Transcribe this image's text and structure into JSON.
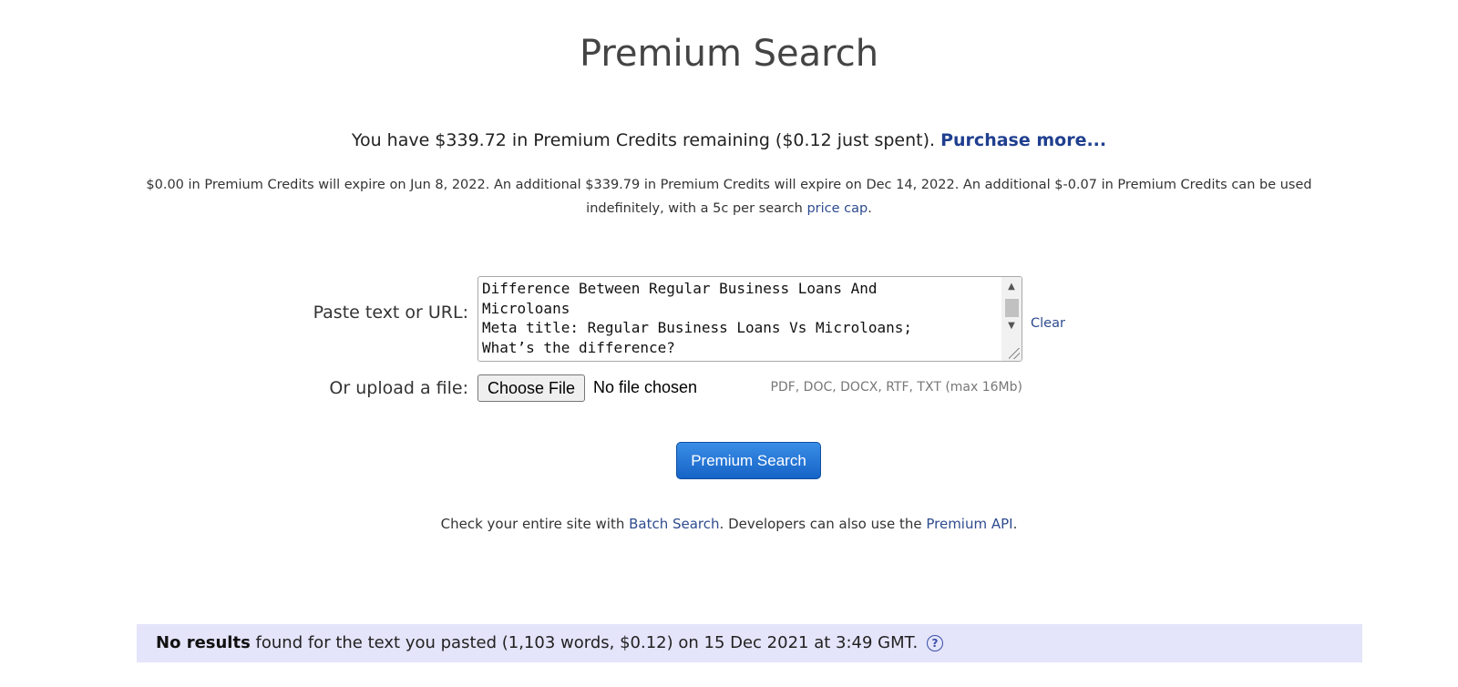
{
  "page": {
    "title": "Premium Search"
  },
  "credits": {
    "line_prefix": "You have $339.72 in Premium Credits remaining ($0.12 just spent). ",
    "purchase_link": "Purchase more...",
    "expiry_text": "$0.00 in Premium Credits will expire on Jun 8, 2022. An additional $339.79 in Premium Credits will expire on Dec 14, 2022. An additional $-0.07 in Premium Credits can be used indefinitely, with a 5c per search ",
    "price_cap_link": "price cap",
    "expiry_suffix": "."
  },
  "form": {
    "paste_label": "Paste text or URL:",
    "textarea_value": "Difference Between Regular Business Loans And\nMicroloans\nMeta title: Regular Business Loans Vs Microloans;\nWhat’s the difference?",
    "clear_link": "Clear",
    "upload_label": "Or upload a file:",
    "choose_file_button": "Choose File",
    "file_status": "No file chosen",
    "file_hint": "PDF, DOC, DOCX, RTF, TXT (max 16Mb)",
    "submit_button": "Premium Search"
  },
  "batch": {
    "prefix": "Check your entire site with ",
    "batch_link": "Batch Search",
    "middle": ". Developers can also use the ",
    "api_link": "Premium API",
    "suffix": "."
  },
  "results": {
    "bold": "No results",
    "text": " found for the text you pasted (1,103 words, $0.12) on 15 Dec 2021 at 3:49 GMT.",
    "help_icon": "question-circle-icon",
    "help_glyph": "?"
  },
  "colors": {
    "link": "#2e4b8f",
    "button_blue": "#1663c7",
    "results_bg": "#e4e4fb"
  }
}
